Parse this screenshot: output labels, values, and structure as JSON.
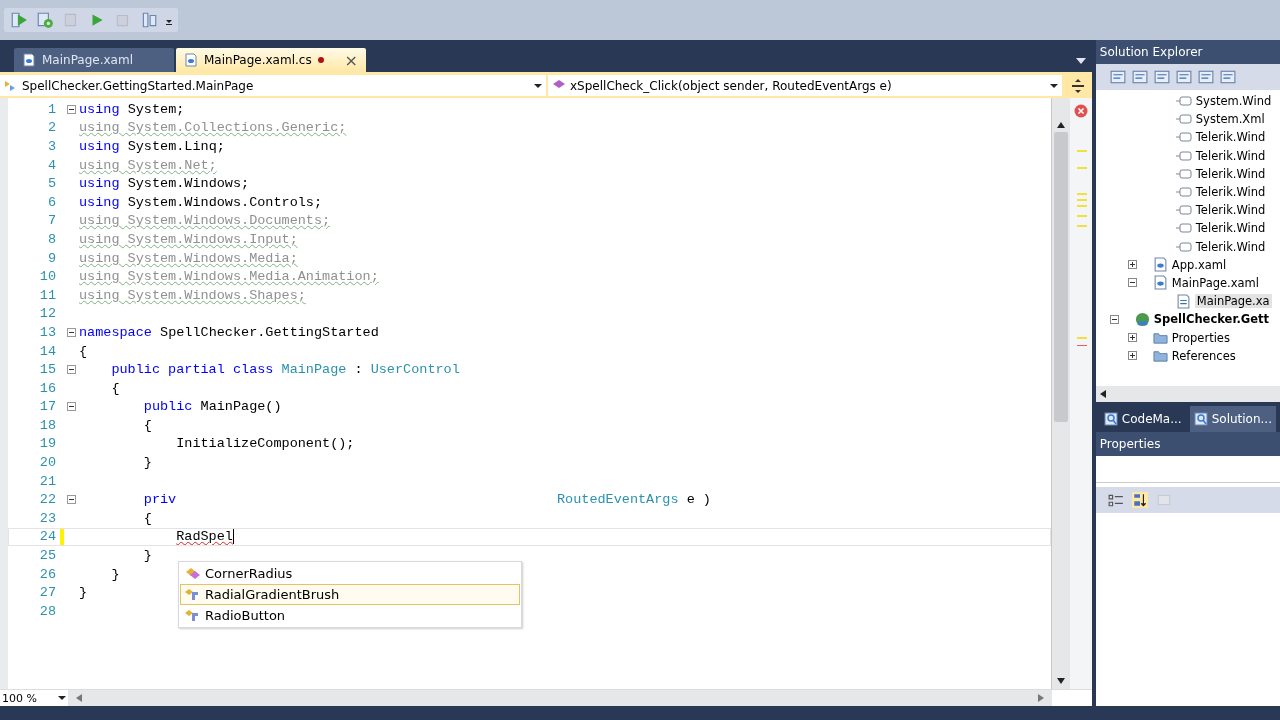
{
  "tabs": [
    {
      "label": "MainPage.xaml",
      "selected": false,
      "modified": false
    },
    {
      "label": "MainPage.xaml.cs",
      "selected": true,
      "modified": true,
      "close": "×"
    }
  ],
  "nav_bar": {
    "type_selector": "SpellChecker.GettingStarted.MainPage",
    "member_selector": "xSpellCheck_Click(object sender, RoutedEventArgs e)"
  },
  "editor": {
    "lines": [
      {
        "number": "1",
        "collapsible": true,
        "tokens": [
          {
            "t": "using",
            "kind": "keyword"
          },
          {
            "t": " System;",
            "kind": "plain"
          }
        ]
      },
      {
        "number": "2",
        "tokens": [
          {
            "t": "using System.Collections.Generic;",
            "kind": "unused"
          }
        ]
      },
      {
        "number": "3",
        "tokens": [
          {
            "t": "using",
            "kind": "keyword"
          },
          {
            "t": " System.Linq;",
            "kind": "plain"
          }
        ]
      },
      {
        "number": "4",
        "tokens": [
          {
            "t": "using System.Net;",
            "kind": "unused"
          }
        ]
      },
      {
        "number": "5",
        "tokens": [
          {
            "t": "using",
            "kind": "keyword"
          },
          {
            "t": " System.Windows;",
            "kind": "plain"
          }
        ]
      },
      {
        "number": "6",
        "tokens": [
          {
            "t": "using",
            "kind": "keyword"
          },
          {
            "t": " System.Windows.Controls;",
            "kind": "plain"
          }
        ]
      },
      {
        "number": "7",
        "tokens": [
          {
            "t": "using System.Windows.Documents;",
            "kind": "unused"
          }
        ]
      },
      {
        "number": "8",
        "tokens": [
          {
            "t": "using System.Windows.Input;",
            "kind": "unused"
          }
        ]
      },
      {
        "number": "9",
        "tokens": [
          {
            "t": "using System.Windows.Media;",
            "kind": "unused"
          }
        ]
      },
      {
        "number": "10",
        "tokens": [
          {
            "t": "using System.Windows.Media.Animation;",
            "kind": "unused"
          }
        ]
      },
      {
        "number": "11",
        "tokens": [
          {
            "t": "using System.Windows.Shapes;",
            "kind": "unused"
          }
        ]
      },
      {
        "number": "12"
      },
      {
        "number": "13",
        "collapsible": true,
        "tokens": [
          {
            "t": "namespace",
            "kind": "keyword"
          },
          {
            "t": " SpellChecker.GettingStarted",
            "kind": "plain"
          }
        ]
      },
      {
        "number": "14",
        "tokens": [
          {
            "t": "{",
            "kind": "plain"
          }
        ]
      },
      {
        "number": "15",
        "collapsible": true,
        "tokens": [
          {
            "t": "    public partial class",
            "kind": "keyword"
          },
          {
            "t": " MainPage",
            "kind": "type"
          },
          {
            "t": " : ",
            "kind": "plain"
          },
          {
            "t": "UserControl",
            "kind": "type"
          }
        ]
      },
      {
        "number": "16",
        "tokens": [
          {
            "t": "    {",
            "kind": "plain"
          }
        ]
      },
      {
        "number": "17",
        "collapsible": true,
        "tokens": [
          {
            "t": "        public",
            "kind": "keyword"
          },
          {
            "t": " MainPage()",
            "kind": "plain"
          }
        ]
      },
      {
        "number": "18",
        "tokens": [
          {
            "t": "        {",
            "kind": "plain"
          }
        ]
      },
      {
        "number": "19",
        "tokens": [
          {
            "t": "            InitializeComponent();",
            "kind": "plain"
          }
        ]
      },
      {
        "number": "20",
        "tokens": [
          {
            "t": "        }",
            "kind": "plain"
          }
        ]
      },
      {
        "number": "21"
      },
      {
        "number": "22",
        "collapsible": true,
        "tokens": [
          {
            "t": "        priv",
            "kind": "keyword"
          },
          {
            "t": "                                               RoutedEventArgs",
            "kind": "type"
          },
          {
            "t": " e )",
            "kind": "plain"
          }
        ]
      },
      {
        "number": "23",
        "tokens": [
          {
            "t": "        {",
            "kind": "plain"
          }
        ]
      },
      {
        "number": "24",
        "changed": true,
        "current": true,
        "tokens": [
          {
            "t": "            RadSpel",
            "kind": "error"
          }
        ]
      },
      {
        "number": "25",
        "tokens": [
          {
            "t": "        }",
            "kind": "plain"
          }
        ]
      },
      {
        "number": "26",
        "tokens": [
          {
            "t": "    }",
            "kind": "plain"
          }
        ]
      },
      {
        "number": "27",
        "tokens": [
          {
            "t": "}",
            "kind": "plain"
          }
        ]
      },
      {
        "number": "28"
      }
    ],
    "completion": [
      {
        "label": "CornerRadius",
        "kind": "struct",
        "selected": false
      },
      {
        "label": "RadialGradientBrush",
        "kind": "class",
        "selected": true
      },
      {
        "label": "RadioButton",
        "kind": "class",
        "selected": false
      }
    ],
    "zoom": "100 %"
  },
  "solution_explorer": {
    "title": "Solution Explorer",
    "references": [
      {
        "label": "System.Wind"
      },
      {
        "label": "System.Xml"
      },
      {
        "label": "Telerik.Wind"
      },
      {
        "label": "Telerik.Wind"
      },
      {
        "label": "Telerik.Wind"
      },
      {
        "label": "Telerik.Wind"
      },
      {
        "label": "Telerik.Wind"
      },
      {
        "label": "Telerik.Wind"
      },
      {
        "label": "Telerik.Wind"
      }
    ],
    "files": [
      {
        "label": "App.xaml",
        "expanded": false
      },
      {
        "label": "MainPage.xaml",
        "expanded": true,
        "children": [
          {
            "label": "MainPage.xa",
            "selected": true
          }
        ]
      }
    ],
    "project": {
      "label": "SpellChecker.Gett",
      "expanded": true,
      "children": [
        {
          "label": "Properties",
          "expanded": false
        },
        {
          "label": "References",
          "expanded": false
        }
      ]
    },
    "bottom_tabs": [
      {
        "label": "CodeMa...",
        "selected": false
      },
      {
        "label": "Solution...",
        "selected": true
      }
    ]
  },
  "properties": {
    "title": "Properties"
  }
}
